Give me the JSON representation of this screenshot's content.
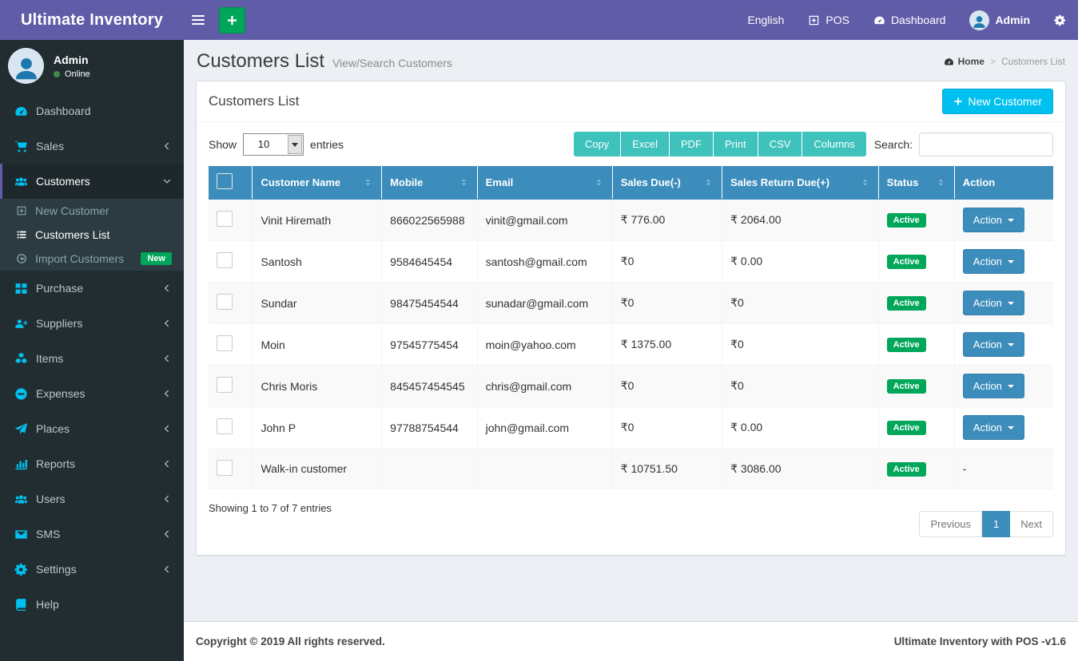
{
  "navbar": {
    "brand": "Ultimate Inventory",
    "language": "English",
    "pos_label": "POS",
    "dashboard_label": "Dashboard",
    "user_name": "Admin"
  },
  "sidebar": {
    "user": {
      "name": "Admin",
      "status": "Online"
    },
    "menu": [
      {
        "label": "Dashboard",
        "icon": "tachometer-icon"
      },
      {
        "label": "Sales",
        "icon": "cart-icon",
        "chevron": "left"
      },
      {
        "label": "Customers",
        "icon": "users-icon",
        "chevron": "down",
        "active": true,
        "children": [
          {
            "label": "New Customer",
            "icon": "plus-square-icon"
          },
          {
            "label": "Customers List",
            "icon": "list-icon",
            "active": true
          },
          {
            "label": "Import Customers",
            "icon": "arrow-circle-left-icon",
            "badge": "New"
          }
        ]
      },
      {
        "label": "Purchase",
        "icon": "th-large-icon",
        "chevron": "left"
      },
      {
        "label": "Suppliers",
        "icon": "user-plus-icon",
        "chevron": "left"
      },
      {
        "label": "Items",
        "icon": "cubes-icon",
        "chevron": "left"
      },
      {
        "label": "Expenses",
        "icon": "minus-circle-icon",
        "chevron": "left"
      },
      {
        "label": "Places",
        "icon": "paper-plane-icon",
        "chevron": "left"
      },
      {
        "label": "Reports",
        "icon": "bar-chart-icon",
        "chevron": "left"
      },
      {
        "label": "Users",
        "icon": "users-icon",
        "chevron": "left"
      },
      {
        "label": "SMS",
        "icon": "envelope-icon",
        "chevron": "left"
      },
      {
        "label": "Settings",
        "icon": "cogs-icon",
        "chevron": "left"
      },
      {
        "label": "Help",
        "icon": "book-icon"
      }
    ]
  },
  "page": {
    "title": "Customers List",
    "subtitle": "View/Search Customers",
    "breadcrumb": {
      "home": "Home",
      "current": "Customers List"
    }
  },
  "panel": {
    "title": "Customers List",
    "new_customer_label": "New Customer",
    "show_label": "Show",
    "entries_label": "entries",
    "page_length": "10",
    "export_buttons": [
      "Copy",
      "Excel",
      "PDF",
      "Print",
      "CSV",
      "Columns"
    ],
    "search_label": "Search:",
    "search_value": "",
    "table": {
      "columns": [
        "Customer Name",
        "Mobile",
        "Email",
        "Sales Due(-)",
        "Sales Return Due(+)",
        "Status",
        "Action"
      ],
      "rows": [
        {
          "name": "Vinit Hiremath",
          "mobile": "866022565988",
          "email": "vinit@gmail.com",
          "sales_due": "₹ 776.00",
          "sales_return_due": "₹ 2064.00",
          "status": "Active",
          "action": "Action"
        },
        {
          "name": "Santosh",
          "mobile": "9584645454",
          "email": "santosh@gmail.com",
          "sales_due": "₹0",
          "sales_return_due": "₹ 0.00",
          "status": "Active",
          "action": "Action"
        },
        {
          "name": "Sundar",
          "mobile": "98475454544",
          "email": "sunadar@gmail.com",
          "sales_due": "₹0",
          "sales_return_due": "₹0",
          "status": "Active",
          "action": "Action"
        },
        {
          "name": "Moin",
          "mobile": "97545775454",
          "email": "moin@yahoo.com",
          "sales_due": "₹ 1375.00",
          "sales_return_due": "₹0",
          "status": "Active",
          "action": "Action"
        },
        {
          "name": "Chris Moris",
          "mobile": "845457454545",
          "email": "chris@gmail.com",
          "sales_due": "₹0",
          "sales_return_due": "₹0",
          "status": "Active",
          "action": "Action"
        },
        {
          "name": "John P",
          "mobile": "97788754544",
          "email": "john@gmail.com",
          "sales_due": "₹0",
          "sales_return_due": "₹ 0.00",
          "status": "Active",
          "action": "Action"
        },
        {
          "name": "Walk-in customer",
          "mobile": "",
          "email": "",
          "sales_due": "₹ 10751.50",
          "sales_return_due": "₹ 3086.00",
          "status": "Active",
          "action": "-"
        }
      ]
    },
    "info": "Showing 1 to 7 of 7 entries",
    "pagination": {
      "previous": "Previous",
      "page": "1",
      "next": "Next"
    }
  },
  "footer": {
    "left": "Copyright © 2019 All rights reserved.",
    "right": "Ultimate Inventory with POS -v1.6"
  },
  "colors": {
    "navbar_purple": "#605ca8",
    "sidebar_dark": "#222d32",
    "sidebar_icon_cyan": "#00c0ef",
    "table_header_blue": "#3c8dbc",
    "export_button_teal": "#3fc2bc",
    "new_customer_cyan": "#00c0ef",
    "success_green": "#00a65a",
    "content_bg": "#ecf0f5"
  }
}
